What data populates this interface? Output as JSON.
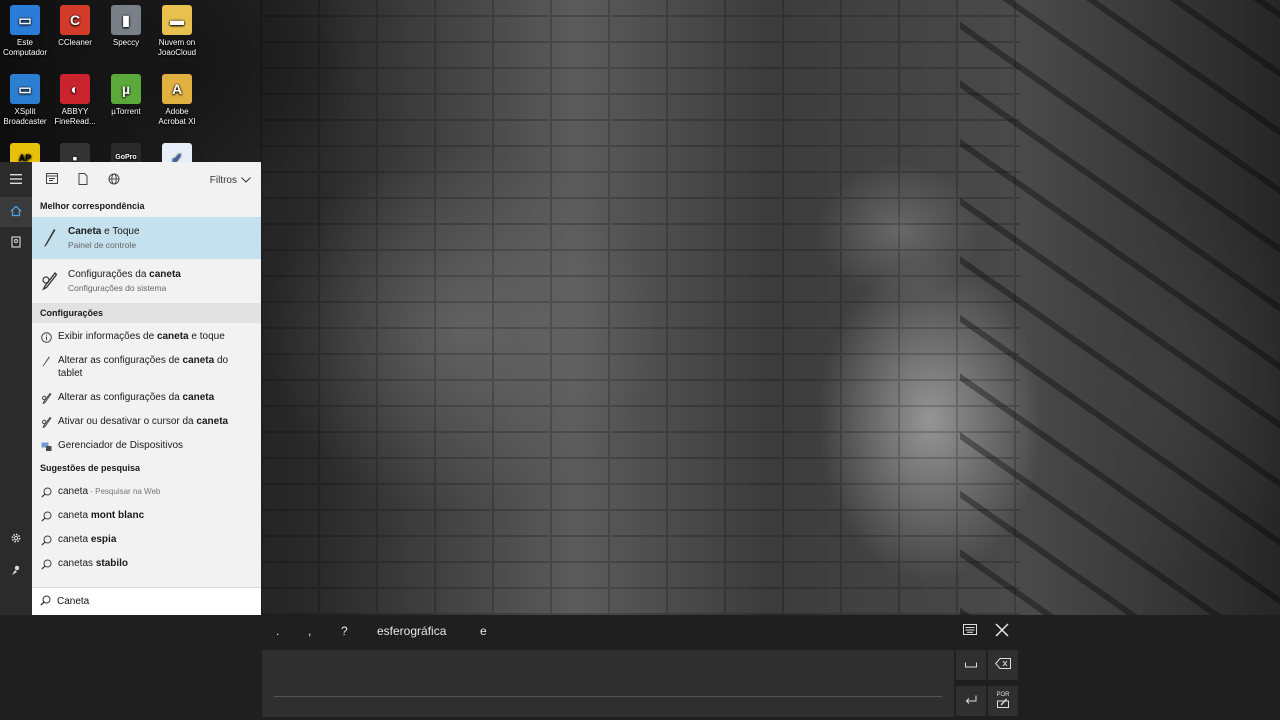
{
  "desktop": {
    "icons": [
      {
        "label": "Este\nComputador",
        "icon": "computer-icon",
        "color": "#2b7bd8",
        "glyph": "▭"
      },
      {
        "label": "CCleaner",
        "icon": "ccleaner-icon",
        "color": "#d23a2a",
        "glyph": "C"
      },
      {
        "label": "Speccy",
        "icon": "speccy-icon",
        "color": "#7a8088",
        "glyph": "▮"
      },
      {
        "label": "Nuvem on\nJoaoCloud",
        "icon": "folder-icon",
        "color": "#e8c050",
        "glyph": "▬"
      },
      {
        "label": "XSplit\nBroadcaster",
        "icon": "xsplit-icon",
        "color": "#2c7fd0",
        "glyph": "▭"
      },
      {
        "label": "ABBYY\nFineRead...",
        "icon": "abbyy-icon",
        "color": "#c9232d",
        "glyph": "◐"
      },
      {
        "label": "µTorrent",
        "icon": "utorrent-icon",
        "color": "#5ba93a",
        "glyph": "µ"
      },
      {
        "label": "Adobe\nAcrobat XI",
        "icon": "acrobat-icon",
        "color": "#e0b040",
        "glyph": "A"
      },
      {
        "label": "",
        "icon": "app-icon",
        "color": "#e8c20a",
        "glyph": "AP"
      },
      {
        "label": "",
        "icon": "app-icon",
        "color": "#333333",
        "glyph": "▪"
      },
      {
        "label": "",
        "icon": "gopro-icon",
        "color": "#2a2a2a",
        "glyph": "GoPro"
      },
      {
        "label": "",
        "icon": "app-icon",
        "color": "#e8eef8",
        "glyph": "✓"
      }
    ]
  },
  "panel": {
    "filters_label": "Filtros",
    "best_match_header": "Melhor correspondência",
    "best_match": [
      {
        "title_bold": "Caneta",
        "title_rest": " e Toque",
        "subtitle": "Painel de controle"
      },
      {
        "title_pre": "Configurações da ",
        "title_bold": "caneta",
        "subtitle": "Configurações do sistema"
      }
    ],
    "settings_header": "Configurações",
    "settings": [
      {
        "pre": "Exibir informações de ",
        "bold": "caneta",
        "post": " e toque",
        "icon": "info-icon"
      },
      {
        "pre": "Alterar as configurações de ",
        "bold": "caneta",
        "post": " do tablet",
        "icon": "pen-icon"
      },
      {
        "pre": "Alterar as configurações da ",
        "bold": "caneta",
        "post": "",
        "icon": "pen-settings-icon"
      },
      {
        "pre": "Ativar ou desativar o cursor da ",
        "bold": "caneta",
        "post": "",
        "icon": "pen-settings-icon"
      },
      {
        "pre": "Gerenciador de Dispositivos",
        "bold": "",
        "post": "",
        "icon": "device-manager-icon"
      }
    ],
    "suggestions_header": "Sugestões de pesquisa",
    "suggestions": [
      {
        "pre": "caneta",
        "bold": "",
        "muted": " - Pesquisar na Web"
      },
      {
        "pre": "caneta ",
        "bold": "mont blanc",
        "muted": ""
      },
      {
        "pre": "caneta ",
        "bold": "espia",
        "muted": ""
      },
      {
        "pre": "canetas ",
        "bold": "stabilo",
        "muted": ""
      }
    ],
    "search_value": "Caneta"
  },
  "keyboard": {
    "suggestions": [
      ".",
      ",",
      "?",
      "esferográfica",
      "e"
    ],
    "lang_label": "POR"
  },
  "colors": {
    "highlight": "#c5e1ee",
    "settings_header_bg": "#e2e2e2",
    "panel_bg": "#f2f2f2",
    "keyboard_bg": "#1f1f1f"
  }
}
